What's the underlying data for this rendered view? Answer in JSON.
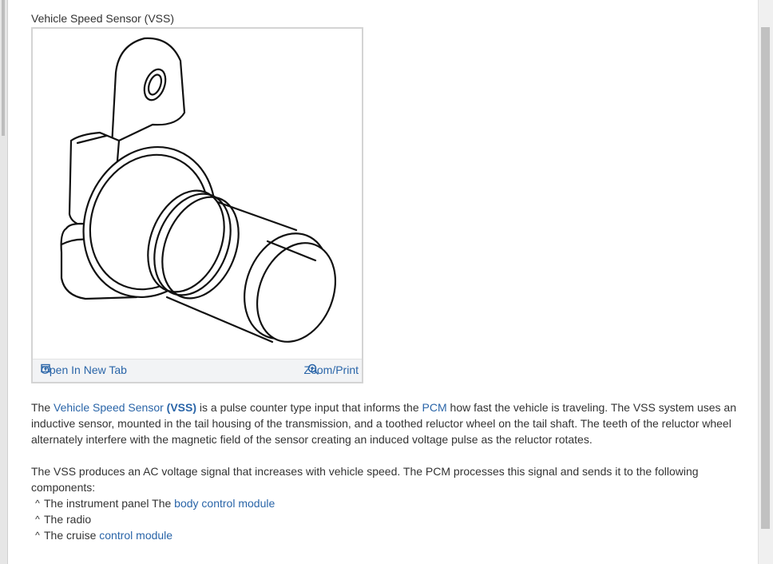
{
  "figure": {
    "title": "Vehicle Speed Sensor (VSS)",
    "open_tab_label": "Open In New Tab",
    "zoom_label": "Zoom/Print",
    "open_tab_icon": "open-tab-icon",
    "zoom_icon": "magnifier-plus-icon"
  },
  "para1": {
    "t1": "The ",
    "link_vss": "Vehicle Speed Sensor",
    "t2": " ",
    "abbr": "(VSS)",
    "t3": " is a pulse counter type input that informs the ",
    "link_pcm": "PCM",
    "t4": " how fast the vehicle is traveling. The VSS system uses an inductive sensor, mounted in the tail housing of the transmission, and a toothed reluctor wheel on the tail shaft. The teeth of the reluctor wheel alternately interfere with the magnetic field of the sensor creating an induced voltage pulse as the reluctor rotates."
  },
  "para2": {
    "text": "The VSS produces an AC voltage signal that increases with vehicle speed. The PCM processes this signal and sends it to the following components:"
  },
  "list": {
    "bullet": "^",
    "item1_text": "The instrument panel The ",
    "item1_link": "body control module",
    "item2_text": "The radio",
    "item3_text": "The cruise ",
    "item3_link": "control module"
  },
  "colors": {
    "link": "#2a65a8",
    "text": "#333333",
    "figure_border": "#d4d4d4",
    "figure_bar": "#f2f3f5"
  }
}
